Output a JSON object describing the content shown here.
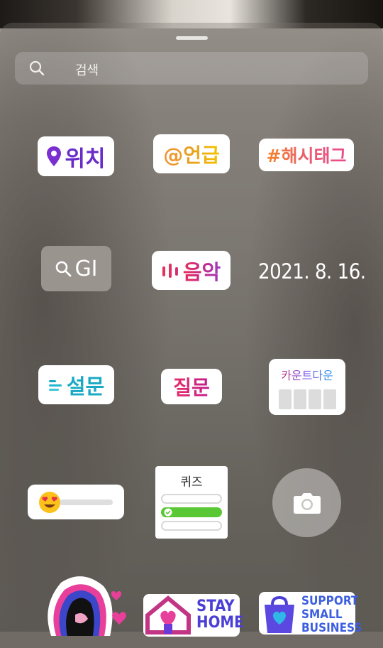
{
  "search": {
    "label": "검색"
  },
  "stickers": {
    "location": "위치",
    "mention": "@언급",
    "hashtag": "#해시태그",
    "gif": "GI",
    "music": "음악",
    "date": "2021. 8. 16.",
    "poll": "설문",
    "question": "질문",
    "countdown": "카운트다운",
    "quiz": "퀴즈",
    "stay_home_line1": "STAY",
    "stay_home_line2": "HOME",
    "support_line1": "SUPPORT",
    "support_line2": "SMALL",
    "support_line3": "BUSINESS"
  },
  "colors": {
    "location": "#6a2cc9",
    "poll": "#1aa9c4",
    "quiz_correct": "#5ac734"
  }
}
